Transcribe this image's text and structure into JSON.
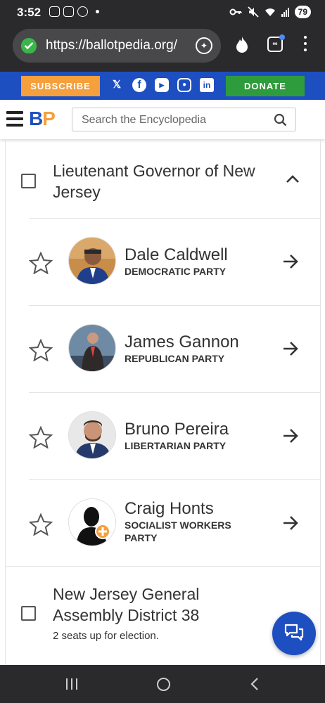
{
  "status_bar": {
    "time": "3:52",
    "battery": "79"
  },
  "browser": {
    "url": "https://ballotpedia.org/"
  },
  "social_bar": {
    "subscribe": "SUBSCRIBE",
    "donate": "DONATE"
  },
  "header": {
    "logo_b": "B",
    "logo_p": "P",
    "search_placeholder": "Search the Encyclopedia"
  },
  "race": {
    "title": "Lieutenant Governor of New Jersey",
    "candidates": [
      {
        "name": "Dale Caldwell",
        "party": "DEMOCRATIC PARTY"
      },
      {
        "name": "James Gannon",
        "party": "REPUBLICAN PARTY"
      },
      {
        "name": "Bruno Pereira",
        "party": "LIBERTARIAN PARTY"
      },
      {
        "name": "Craig Honts",
        "party": "SOCIALIST WORKERS PARTY"
      }
    ]
  },
  "race2": {
    "title": "New Jersey General Assembly District 38",
    "subtitle": "2 seats up for election."
  },
  "colors": {
    "brand_blue": "#1e4fc1",
    "brand_orange": "#f5a03c",
    "donate_green": "#2e9c3c"
  }
}
